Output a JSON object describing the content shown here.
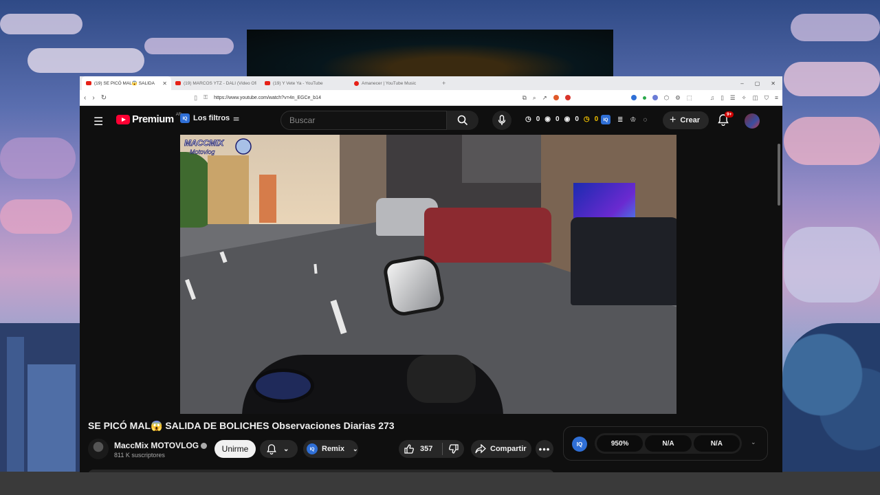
{
  "browser": {
    "tabs": [
      {
        "title": "(19) SE PICÓ MAL😱 SALIDA",
        "active": true
      },
      {
        "title": "(19) MARCOS YTZ - DALI (Video Ofi",
        "active": false
      },
      {
        "title": "(19) Y Vete Ya - YouTube",
        "active": false
      },
      {
        "title": "Amanecer | YouTube Music",
        "active": false
      }
    ],
    "url": "https://www.youtube.com/watch?v=4n_EGCe_b14",
    "window_controls": {
      "minimize": "–",
      "maximize": "▢",
      "close": "✕"
    },
    "new_tab": "+"
  },
  "youtube": {
    "logo": "Premium",
    "country": "AR",
    "filters_label": "Los filtros",
    "search_placeholder": "Buscar",
    "stats": [
      "0",
      "0",
      "0",
      "0"
    ],
    "create_label": "Crear",
    "notification_badge": "9+"
  },
  "video": {
    "watermark_line1": "MACCMIX",
    "watermark_line2": "Motovlog",
    "title": "SE PICÓ MAL😱 SALIDA DE BOLICHES Observaciones Diarias 273",
    "channel_name": "MaccMix MOTOVLOG",
    "subscribers": "811 K suscriptores",
    "join_label": "Unirme",
    "remix_label": "Remix",
    "likes": "357",
    "share_label": "Compartir"
  },
  "iq_panel": {
    "logo": "IQ",
    "values": [
      "950%",
      "N/A",
      "N/A"
    ]
  },
  "colors": {
    "youtube_red": "#ff0033",
    "bg_dark": "#0f0f0f",
    "pill": "#272727",
    "iq_blue": "#2f6fd6"
  }
}
